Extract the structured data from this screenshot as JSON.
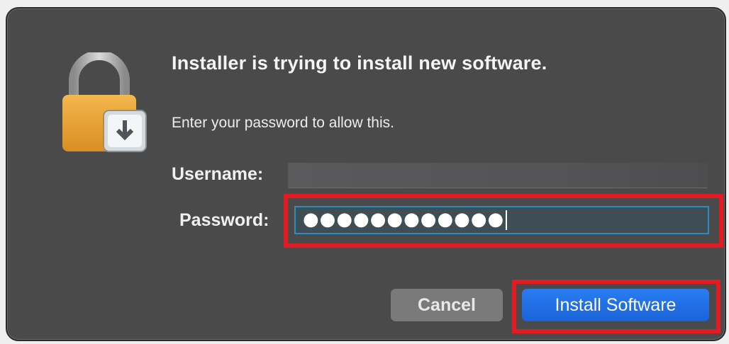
{
  "dialog": {
    "title": "Installer is trying to install new software.",
    "subtitle": "Enter your password to allow this.",
    "username_label": "Username:",
    "username_value": "",
    "password_label": "Password:",
    "password_masked": "●●●●●●●●●●●●",
    "cancel_label": "Cancel",
    "install_label": "Install Software"
  },
  "icons": {
    "lock": "lock-icon",
    "installer_badge": "installer-badge-icon"
  },
  "colors": {
    "dialog_bg": "#4a4a4b",
    "primary_button": "#1f6fe5",
    "highlight": "#e31b23",
    "lock_body": "#e9a43a"
  }
}
